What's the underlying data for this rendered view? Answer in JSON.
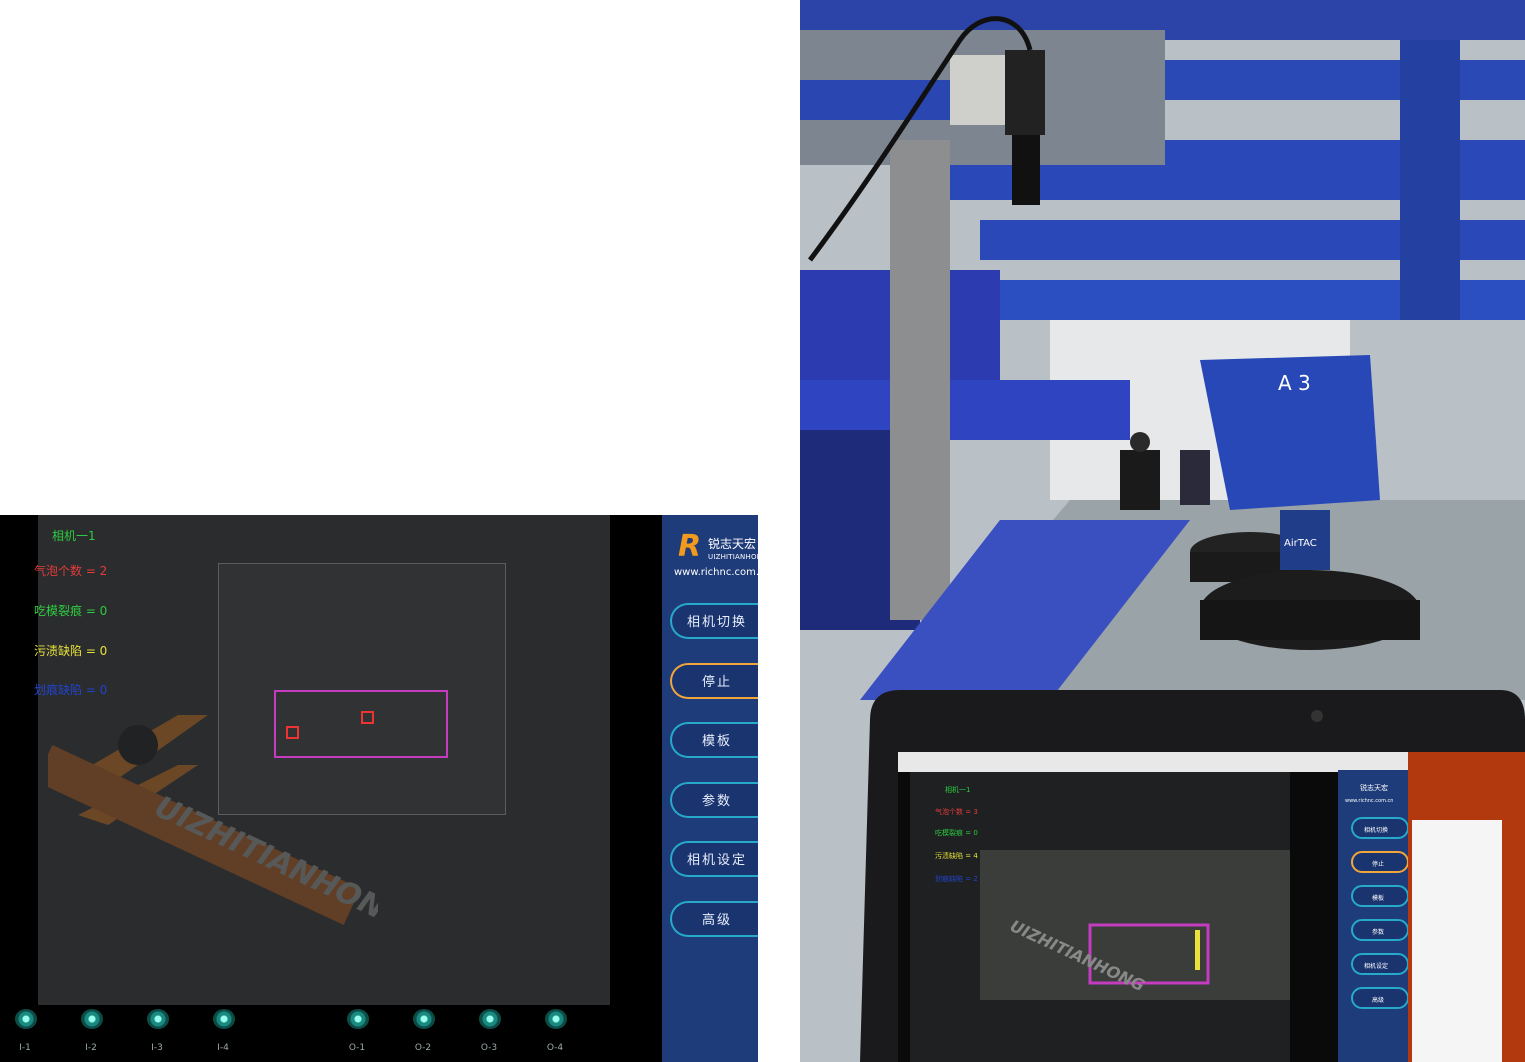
{
  "ui": {
    "stats": [
      {
        "label": "相机一1",
        "color": "#2ecc40"
      },
      {
        "label": "气泡个数 = 2",
        "color": "#e53b3b"
      },
      {
        "label": "吃模裂痕 = 0",
        "color": "#2ecc40"
      },
      {
        "label": "污渍缺陷 = 0",
        "color": "#e8e23a"
      },
      {
        "label": "划痕缺陷 = 0",
        "color": "#2244cc"
      }
    ],
    "brand": {
      "logo_mark": "R",
      "name_cn": "锐志天宏",
      "name_en": "UIZHITIANHONG",
      "url": "www.richnc.com.cn"
    },
    "buttons": [
      {
        "label": "相机切换",
        "active": false
      },
      {
        "label": "停止",
        "active": true
      },
      {
        "label": "模板",
        "active": false
      },
      {
        "label": "参数",
        "active": false
      },
      {
        "label": "相机设定",
        "active": false
      },
      {
        "label": "高级",
        "active": false
      }
    ],
    "io": [
      "I-1",
      "I-2",
      "I-3",
      "I-4",
      "O-1",
      "O-2",
      "O-3",
      "O-4"
    ],
    "watermark": "UIZHITIANHONG",
    "colors": {
      "roi": "#c43cc0",
      "defect": "#e33333",
      "button_border": "#27a9c9",
      "active_border": "#f0a63a",
      "sidebar": "#1f3c7a"
    }
  },
  "photo": {
    "beam_label": "A 3",
    "cylinder_label": "AirTAC",
    "screen": {
      "stats": [
        {
          "label": "相机一1",
          "color": "#2ecc40"
        },
        {
          "label": "气泡个数 = 3",
          "color": "#e53b3b"
        },
        {
          "label": "吃模裂痕 = 0",
          "color": "#2ecc40"
        },
        {
          "label": "污渍缺陷 = 4",
          "color": "#e8e23a"
        },
        {
          "label": "划痕缺陷 = 2",
          "color": "#2244cc"
        }
      ],
      "brand_cn": "锐志天宏",
      "url": "www.richnc.com.cn",
      "buttons": [
        "相机切换",
        "停止",
        "模板",
        "参数",
        "相机设定",
        "高级"
      ],
      "watermark": "UIZHITIANHONG"
    }
  }
}
